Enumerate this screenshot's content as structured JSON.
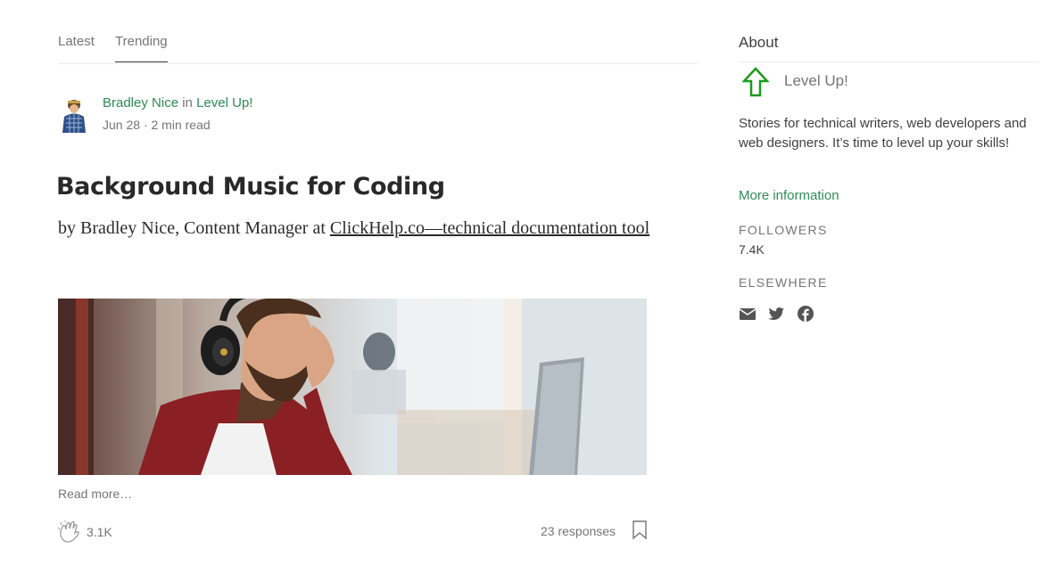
{
  "tabs": [
    {
      "label": "Latest"
    },
    {
      "label": "Trending"
    }
  ],
  "post": {
    "author": "Bradley Nice",
    "in_word": "in",
    "publication": "Level Up!",
    "date": "Jun 28",
    "separator": "·",
    "read_time": "2 min read",
    "title": "Background Music for Coding",
    "subtitle_prefix": "by Bradley Nice, Content Manager at ",
    "subtitle_link": "ClickHelp.co—technical documentation tool",
    "read_more": "Read more…",
    "claps": "3.1K",
    "responses": "23 responses"
  },
  "about": {
    "title": "About",
    "publication_name": "Level Up!",
    "description": "Stories for technical writers, web developers and web designers. It’s time to level up your skills!",
    "more_info": "More information",
    "followers_label": "FOLLOWERS",
    "followers_value": "7.4K",
    "elsewhere_label": "ELSEWHERE",
    "social_icons": [
      "mail-icon",
      "twitter-icon",
      "facebook-icon"
    ]
  },
  "colors": {
    "accent_green": "#2e8b57",
    "muted_text": "#757575",
    "logo_green": "#1a9a1a"
  }
}
